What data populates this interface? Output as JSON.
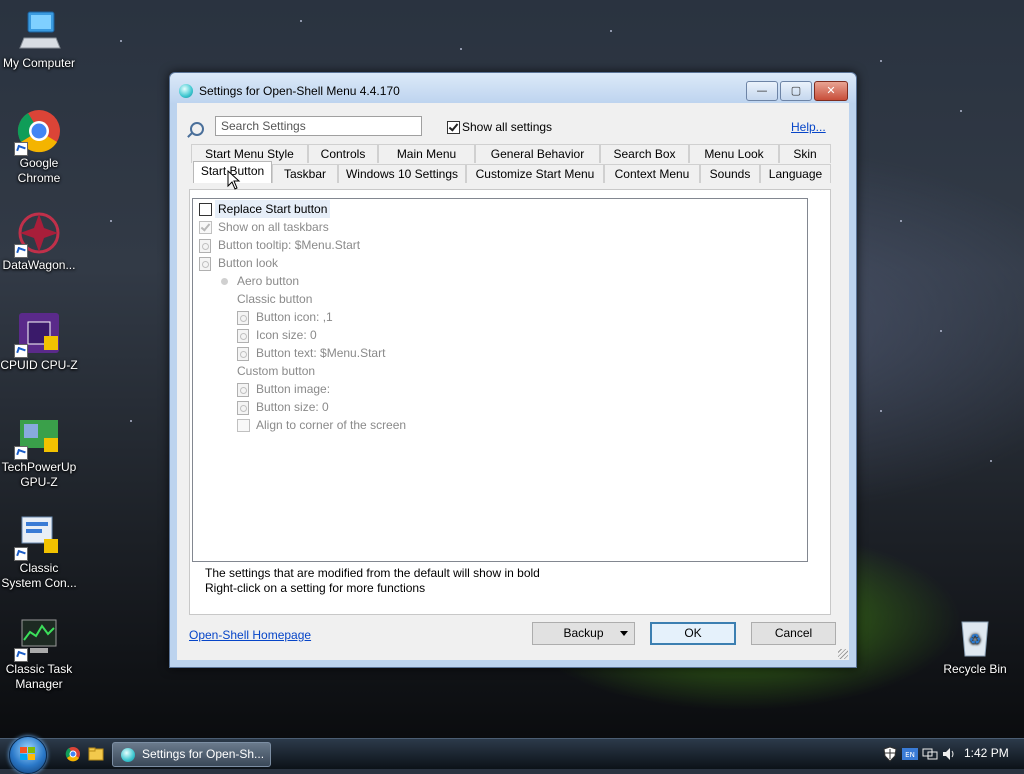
{
  "desktop": {
    "icons": [
      {
        "label": "My Computer"
      },
      {
        "label": "Google Chrome"
      },
      {
        "label": "DataWagon..."
      },
      {
        "label": "CPUID CPU-Z"
      },
      {
        "label": "TechPowerUp GPU-Z"
      },
      {
        "label": "Classic System Con..."
      },
      {
        "label": "Classic Task Manager"
      },
      {
        "label": "Recycle Bin"
      }
    ]
  },
  "dialog": {
    "title": "Settings for Open-Shell Menu 4.4.170",
    "caption_buttons": {
      "minimize": "—",
      "maximize": "▢",
      "close": "✕"
    },
    "search": {
      "placeholder": "Search Settings",
      "value": ""
    },
    "show_all_settings": {
      "label": "Show all settings",
      "checked": true
    },
    "help_link": "Help...",
    "tabs_row1": [
      "Start Menu Style",
      "Controls",
      "Main Menu",
      "General Behavior",
      "Search Box",
      "Menu Look",
      "Skin"
    ],
    "tabs_row2": [
      "Start Button",
      "Taskbar",
      "Windows 10 Settings",
      "Customize Start Menu",
      "Context Menu",
      "Sounds",
      "Language"
    ],
    "active_tab": "Start Button",
    "settings": [
      "Replace Start button",
      "Show on all taskbars",
      "Button tooltip: $Menu.Start",
      "Button look",
      "Aero button",
      "Classic button",
      "Button icon: ,1",
      "Icon size: 0",
      "Button text: $Menu.Start",
      "Custom button",
      "Button image:",
      "Button size: 0",
      "Align to corner of the screen"
    ],
    "info_line1": "The settings that are modified from the default will show in bold",
    "info_line2": "Right-click on a setting for more functions",
    "homepage_link": "Open-Shell Homepage",
    "buttons": {
      "backup": "Backup",
      "ok": "OK",
      "cancel": "Cancel"
    }
  },
  "taskbar": {
    "task_label": "Settings for Open-Sh...",
    "clock": "1:42 PM"
  },
  "colors": {
    "accent": "#3c7fb1",
    "link": "#0645c8",
    "dialog_frame": "#bcd3ee"
  }
}
